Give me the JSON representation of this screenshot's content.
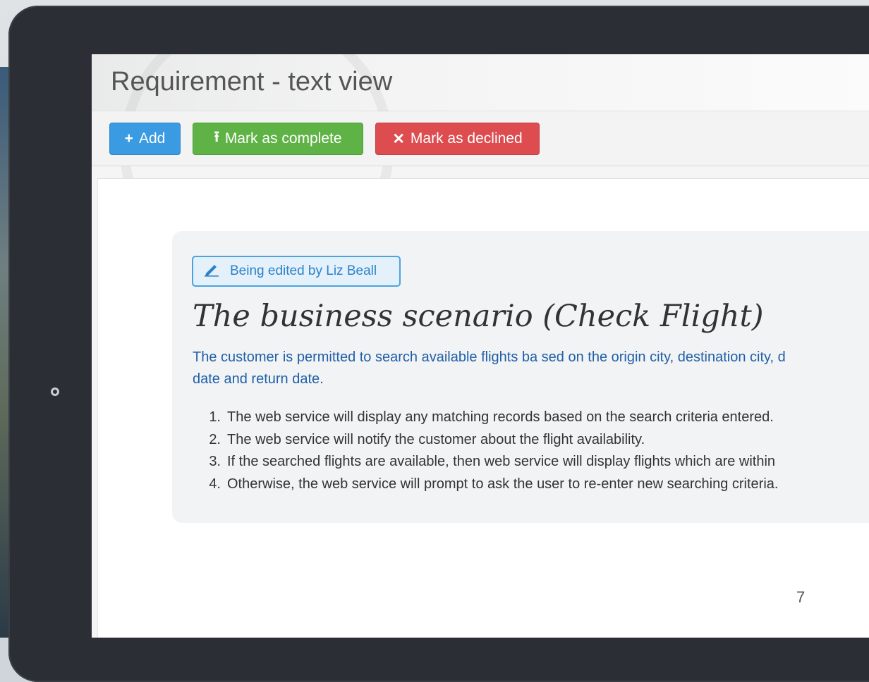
{
  "page": {
    "title": "Requirement - text view"
  },
  "toolbar": {
    "add_label": "Add",
    "complete_label": "Mark as complete",
    "declined_label": "Mark as declined",
    "add_icon": "+",
    "complete_icon": "⭱",
    "declined_icon": "✕"
  },
  "editing": {
    "label": "Being edited by Liz Beall",
    "icon": "pencil-icon"
  },
  "requirement": {
    "title": "The business scenario (Check Flight)",
    "intro_line1": "The customer is permitted to search available flights ba sed on the origin city, destination city, d",
    "intro_line2": "date and return date.",
    "steps": [
      {
        "num": "1.",
        "text": "The web service will display any matching records based on the search criteria entered."
      },
      {
        "num": "2.",
        "text": "The web service will notify the customer about the flight availability."
      },
      {
        "num": "3.",
        "text": "If the searched flights are available, then web service will display flights which are within"
      },
      {
        "num": "4.",
        "text": "Otherwise, the web service will prompt to ask the user to re-enter new searching criteria."
      }
    ]
  },
  "footer": {
    "page_number": "7"
  },
  "colors": {
    "add": "#3a9be3",
    "complete": "#5fb346",
    "declined": "#dd4c4f",
    "intro_text": "#1f5fa8",
    "badge_border": "#4aa3e0"
  }
}
